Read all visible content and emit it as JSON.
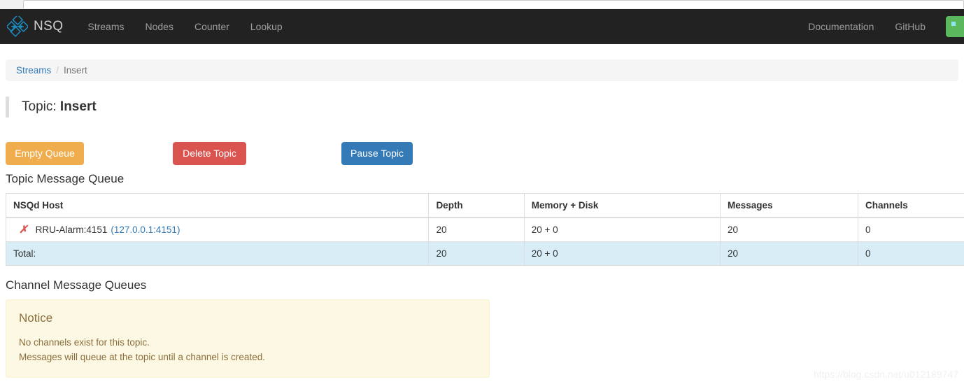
{
  "browser": {
    "urlbar_value": ""
  },
  "navbar": {
    "brand": "NSQ",
    "brand_icon": "nsq-diamond-logo",
    "links": [
      {
        "label": "Streams"
      },
      {
        "label": "Nodes"
      },
      {
        "label": "Counter"
      },
      {
        "label": "Lookup"
      }
    ],
    "right_links": [
      {
        "label": "Documentation"
      },
      {
        "label": "GitHub"
      }
    ],
    "status_badge_color": "#5cb85c"
  },
  "breadcrumb": {
    "parent": "Streams",
    "separator": "/",
    "current": "Insert"
  },
  "page": {
    "title_prefix": "Topic:",
    "title_value": "Insert"
  },
  "actions": {
    "empty_queue": "Empty Queue",
    "delete_topic": "Delete Topic",
    "pause_topic": "Pause Topic",
    "empty_queue_color": "#f0ad4e",
    "delete_topic_color": "#d9534f",
    "pause_topic_color": "#337ab7"
  },
  "topic_queue": {
    "section_title": "Topic Message Queue",
    "columns": [
      "NSQd Host",
      "Depth",
      "Memory + Disk",
      "Messages",
      "Channels"
    ],
    "rows": [
      {
        "status_icon": "x-mark-icon",
        "host": "RRU-Alarm:4151",
        "address": "(127.0.0.1:4151)",
        "depth": "20",
        "memory_disk": "20 + 0",
        "messages": "20",
        "channels": "0"
      }
    ],
    "total": {
      "label": "Total:",
      "depth": "20",
      "memory_disk": "20 + 0",
      "messages": "20",
      "channels": "0"
    }
  },
  "channel_queues": {
    "section_title": "Channel Message Queues",
    "notice": {
      "heading": "Notice",
      "line1": "No channels exist for this topic.",
      "line2": "Messages will queue at the topic until a channel is created."
    }
  },
  "watermark": {
    "text": "https://blog.csdn.net/u012189747"
  }
}
